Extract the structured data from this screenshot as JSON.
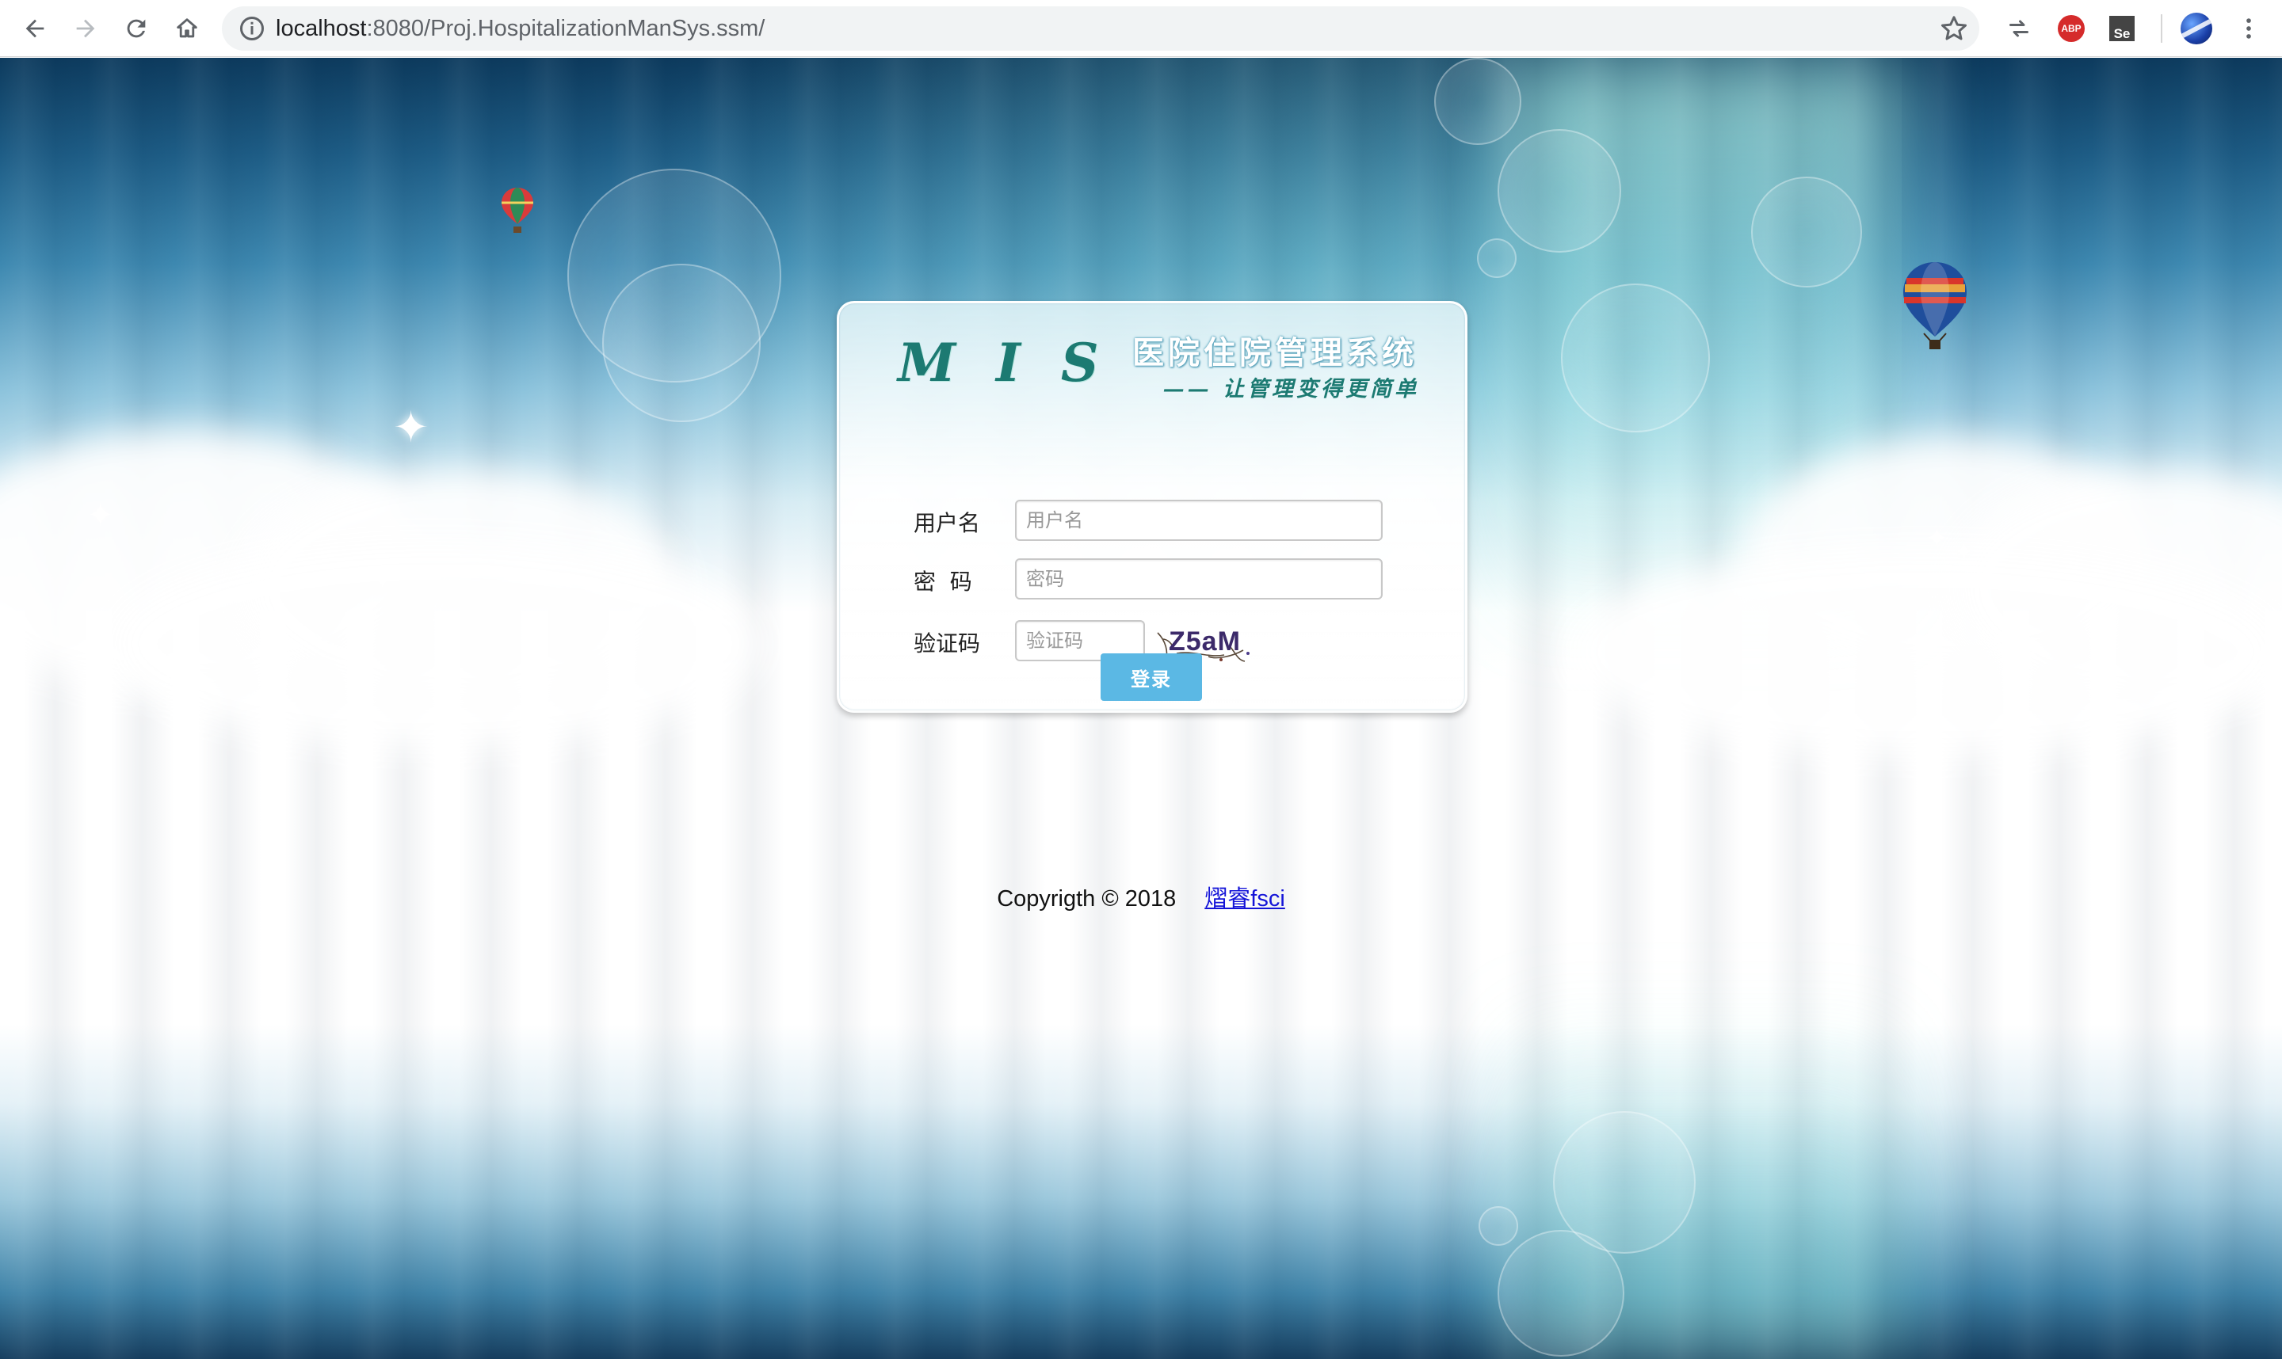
{
  "browser": {
    "url_host": "localhost",
    "url_rest": ":8080/Proj.HospitalizationManSys.ssm/",
    "extensions": {
      "adblock_label": "ABP",
      "selenium_label": "Se"
    }
  },
  "login": {
    "brand": "M I S",
    "system_title": "医院住院管理系统",
    "slogan": "—— 让管理变得更简单",
    "username_label": "用户名",
    "username_placeholder": "用户名",
    "password_label": "密  码",
    "password_placeholder": "密码",
    "captcha_label": "验证码",
    "captcha_placeholder": "验证码",
    "captcha_text": "Z5aM",
    "submit_label": "登录"
  },
  "footer": {
    "copyright": "Copyrigth © 2018",
    "author_link": "熠睿fsci"
  },
  "colors": {
    "brand": "#1c7a72",
    "button": "#5bb8e4",
    "link": "#1414d8"
  }
}
